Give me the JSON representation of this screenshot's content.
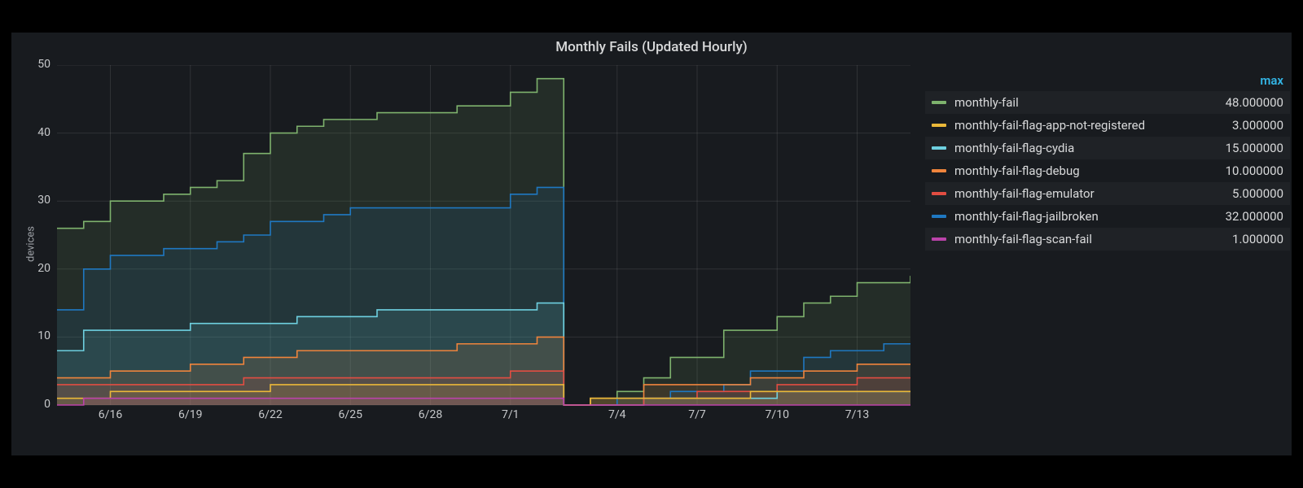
{
  "title": "Monthly Fails (Updated Hourly)",
  "ylabel": "devices",
  "legend_header": "max",
  "y_ticks": [
    "0",
    "10",
    "20",
    "30",
    "40",
    "50"
  ],
  "x_ticks": [
    "6/16",
    "6/19",
    "6/22",
    "6/25",
    "6/28",
    "7/1",
    "7/4",
    "7/7",
    "7/10",
    "7/13"
  ],
  "colors": {
    "monthly_fail": "#7eb26d",
    "app_not_reg": "#eab839",
    "cydia": "#6ed0e0",
    "debug": "#ef843c",
    "emulator": "#e24d42",
    "jailbroken": "#1f78c1",
    "scan_fail": "#ba43a9"
  },
  "legend": [
    {
      "name": "monthly-fail",
      "max": "48.000000",
      "color": "#7eb26d"
    },
    {
      "name": "monthly-fail-flag-app-not-registered",
      "max": "3.000000",
      "color": "#eab839"
    },
    {
      "name": "monthly-fail-flag-cydia",
      "max": "15.000000",
      "color": "#6ed0e0"
    },
    {
      "name": "monthly-fail-flag-debug",
      "max": "10.000000",
      "color": "#ef843c"
    },
    {
      "name": "monthly-fail-flag-emulator",
      "max": "5.000000",
      "color": "#e24d42"
    },
    {
      "name": "monthly-fail-flag-jailbroken",
      "max": "32.000000",
      "color": "#1f78c1"
    },
    {
      "name": "monthly-fail-flag-scan-fail",
      "max": "1.000000",
      "color": "#ba43a9"
    }
  ],
  "chart_data": {
    "type": "area",
    "title": "Monthly Fails (Updated Hourly)",
    "xlabel": "",
    "ylabel": "devices",
    "ylim": [
      0,
      50
    ],
    "x": [
      "6/14",
      "6/15",
      "6/16",
      "6/17",
      "6/18",
      "6/19",
      "6/20",
      "6/21",
      "6/22",
      "6/23",
      "6/24",
      "6/25",
      "6/26",
      "6/27",
      "6/28",
      "6/29",
      "6/30",
      "7/1",
      "7/2",
      "7/2b",
      "7/3",
      "7/4",
      "7/5",
      "7/6",
      "7/7",
      "7/8",
      "7/9",
      "7/10",
      "7/11",
      "7/12",
      "7/13",
      "7/14",
      "7/15"
    ],
    "series": [
      {
        "name": "monthly-fail",
        "color": "#7eb26d",
        "values": [
          26,
          27,
          30,
          30,
          31,
          32,
          33,
          37,
          40,
          41,
          42,
          42,
          43,
          43,
          43,
          44,
          44,
          46,
          48,
          0,
          1,
          2,
          4,
          7,
          7,
          11,
          11,
          13,
          15,
          16,
          18,
          18,
          19
        ]
      },
      {
        "name": "monthly-fail-flag-jailbroken",
        "color": "#1f78c1",
        "values": [
          14,
          20,
          22,
          22,
          23,
          23,
          24,
          25,
          27,
          27,
          28,
          29,
          29,
          29,
          29,
          29,
          29,
          31,
          32,
          0,
          0,
          1,
          1,
          2,
          2,
          3,
          5,
          5,
          7,
          8,
          8,
          9,
          9
        ]
      },
      {
        "name": "monthly-fail-flag-cydia",
        "color": "#6ed0e0",
        "values": [
          8,
          11,
          11,
          11,
          11,
          12,
          12,
          12,
          12,
          13,
          13,
          13,
          14,
          14,
          14,
          14,
          14,
          14,
          15,
          0,
          0,
          0,
          1,
          1,
          1,
          1,
          1,
          2,
          2,
          2,
          2,
          2,
          2
        ]
      },
      {
        "name": "monthly-fail-flag-debug",
        "color": "#ef843c",
        "values": [
          4,
          4,
          5,
          5,
          5,
          6,
          6,
          7,
          7,
          8,
          8,
          8,
          8,
          8,
          8,
          9,
          9,
          9,
          10,
          0,
          1,
          1,
          3,
          3,
          3,
          3,
          4,
          4,
          5,
          5,
          6,
          6,
          6
        ]
      },
      {
        "name": "monthly-fail-flag-emulator",
        "color": "#e24d42",
        "values": [
          3,
          3,
          3,
          3,
          3,
          3,
          3,
          4,
          4,
          4,
          4,
          4,
          4,
          4,
          4,
          4,
          4,
          5,
          5,
          0,
          0,
          0,
          1,
          1,
          2,
          2,
          2,
          3,
          3,
          3,
          4,
          4,
          4
        ]
      },
      {
        "name": "monthly-fail-flag-app-not-registered",
        "color": "#eab839",
        "values": [
          1,
          1,
          2,
          2,
          2,
          2,
          2,
          2,
          3,
          3,
          3,
          3,
          3,
          3,
          3,
          3,
          3,
          3,
          3,
          0,
          1,
          1,
          1,
          1,
          1,
          1,
          2,
          2,
          2,
          2,
          2,
          2,
          2
        ]
      },
      {
        "name": "monthly-fail-flag-scan-fail",
        "color": "#ba43a9",
        "values": [
          0,
          1,
          1,
          1,
          1,
          1,
          1,
          1,
          1,
          1,
          1,
          1,
          1,
          1,
          1,
          1,
          1,
          1,
          1,
          0,
          0,
          0,
          0,
          0,
          0,
          0,
          0,
          0,
          0,
          0,
          0,
          0,
          0
        ]
      }
    ]
  }
}
